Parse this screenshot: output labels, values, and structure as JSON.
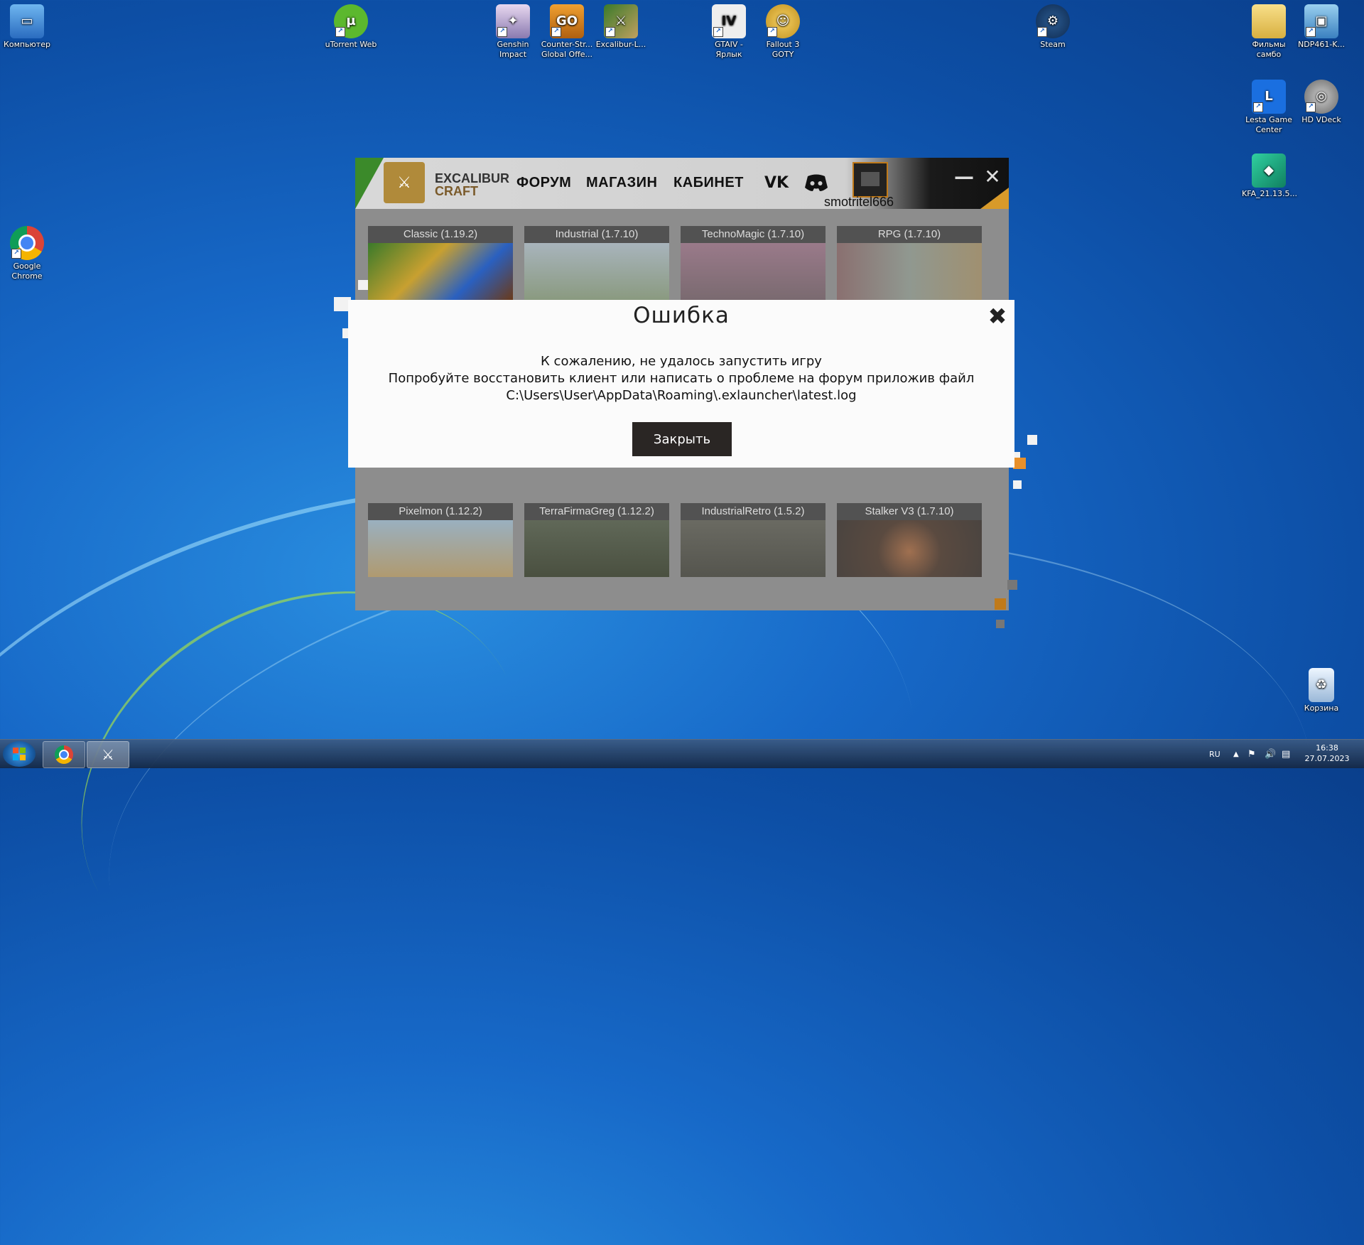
{
  "desktop": {
    "icons": [
      {
        "label": "Компьютер"
      },
      {
        "label": "uTorrent Web"
      },
      {
        "label": "Genshin Impact"
      },
      {
        "label": "Counter-Str... Global Offe..."
      },
      {
        "label": "Excalibur-L..."
      },
      {
        "label": "GTAIV - Ярлык"
      },
      {
        "label": "Fallout 3 GOTY"
      },
      {
        "label": "Steam"
      },
      {
        "label": "Фильмы самбо"
      },
      {
        "label": "NDP461-K..."
      },
      {
        "label": "Lesta Game Center"
      },
      {
        "label": "HD VDeck"
      },
      {
        "label": "KFA_21.13.5..."
      },
      {
        "label": "Google Chrome"
      },
      {
        "label": "Корзина"
      }
    ],
    "glyphs": {
      "csgo": "GO",
      "gta": "IV",
      "lesta": "L"
    }
  },
  "launcher": {
    "logo_line1": "EXCALIBUR",
    "logo_line2": "CRAFT",
    "nav": [
      "ФОРУМ",
      "МАГАЗИН",
      "КАБИНЕТ"
    ],
    "social": [
      "vk-icon",
      "discord-icon"
    ],
    "vk_text": "VK",
    "username": "smotritel666",
    "servers_row1": [
      "Classic (1.19.2)",
      "Industrial (1.7.10)",
      "TechnoMagic (1.7.10)",
      "RPG (1.7.10)"
    ],
    "servers_row3": [
      "Pixelmon (1.12.2)",
      "TerraFirmaGreg (1.12.2)",
      "IndustrialRetro (1.5.2)",
      "Stalker V3 (1.7.10)"
    ]
  },
  "modal": {
    "title": "Ошибка",
    "line1": "К сожалению, не удалось запустить игру",
    "line2": "Попробуйте восстановить клиент или написать о проблеме на форум приложив файл",
    "line3": "C:\\Users\\User\\AppData\\Roaming\\.exlauncher\\latest.log",
    "button": "Закрыть"
  },
  "taskbar": {
    "lang": "RU",
    "time": "16:38",
    "date": "27.07.2023"
  },
  "colors": {
    "accent_orange": "#d89a2a",
    "launcher_green": "#3b8a2a",
    "button_dark": "#2a2624"
  }
}
